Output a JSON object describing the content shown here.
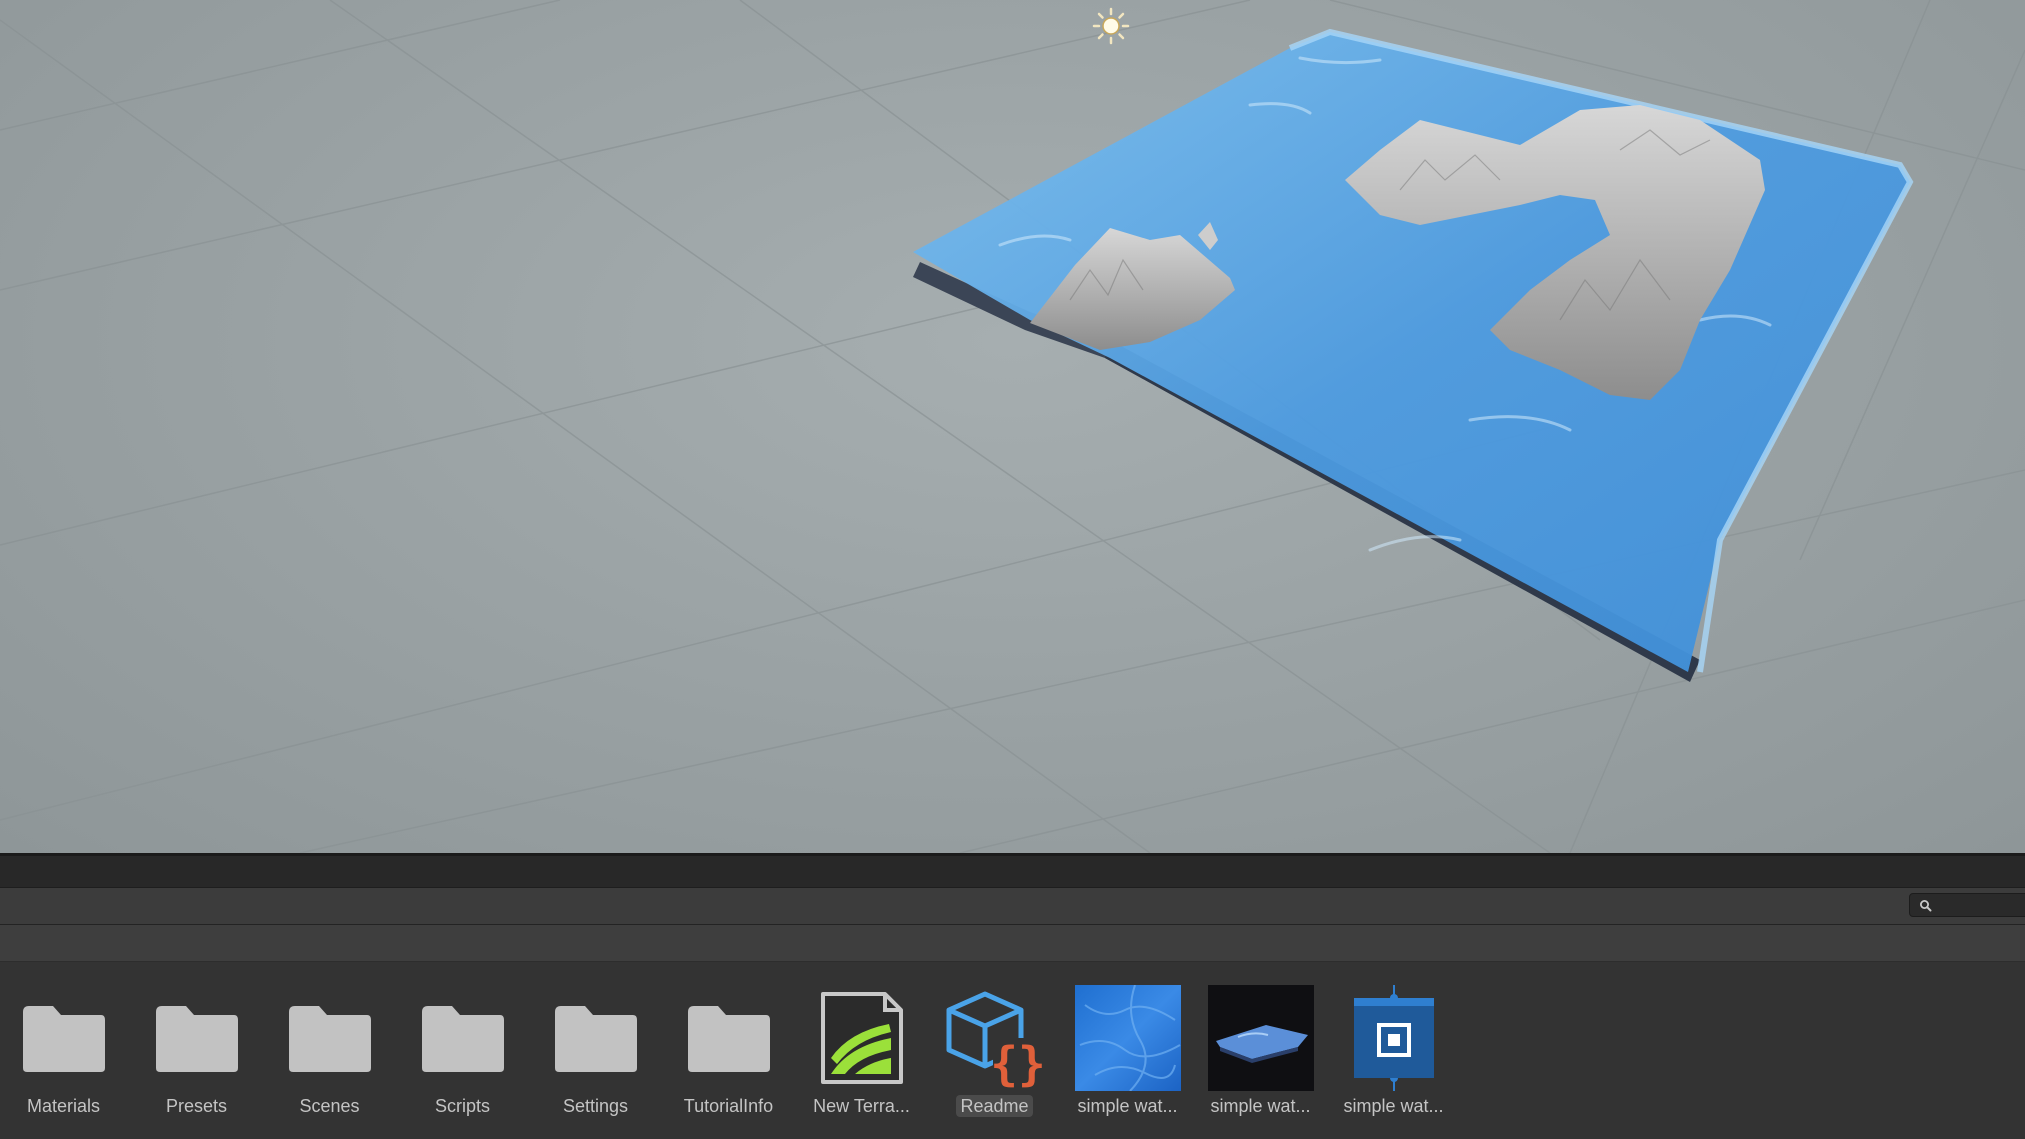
{
  "search": {
    "placeholder": "",
    "value": ""
  },
  "assets": [
    {
      "label": "Materials",
      "icon": "folder-icon",
      "kind": "folder"
    },
    {
      "label": "Presets",
      "icon": "folder-icon",
      "kind": "folder"
    },
    {
      "label": "Scenes",
      "icon": "folder-icon",
      "kind": "folder"
    },
    {
      "label": "Scripts",
      "icon": "folder-icon",
      "kind": "folder"
    },
    {
      "label": "Settings",
      "icon": "folder-icon",
      "kind": "folder"
    },
    {
      "label": "TutorialInfo",
      "icon": "folder-icon",
      "kind": "folder"
    },
    {
      "label": "New Terra...",
      "icon": "terrain-asset-icon",
      "kind": "terrain"
    },
    {
      "label": "Readme",
      "icon": "readme-script-icon",
      "kind": "script",
      "selected": true
    },
    {
      "label": "simple wat...",
      "icon": "water-texture-thumbnail",
      "kind": "texture"
    },
    {
      "label": "simple wat...",
      "icon": "water-material-thumbnail",
      "kind": "material"
    },
    {
      "label": "simple wat...",
      "icon": "water-prefab-icon",
      "kind": "prefab"
    }
  ],
  "colors": {
    "scene_background": "#9ba3a5",
    "water": "#4d9be0",
    "panel": "#333333",
    "folder": "#c2c2c2",
    "label_text": "#c4c4c4",
    "terrain_green": "#9be03a",
    "readme_blue": "#4aa3e8",
    "readme_orange": "#e0603a"
  }
}
